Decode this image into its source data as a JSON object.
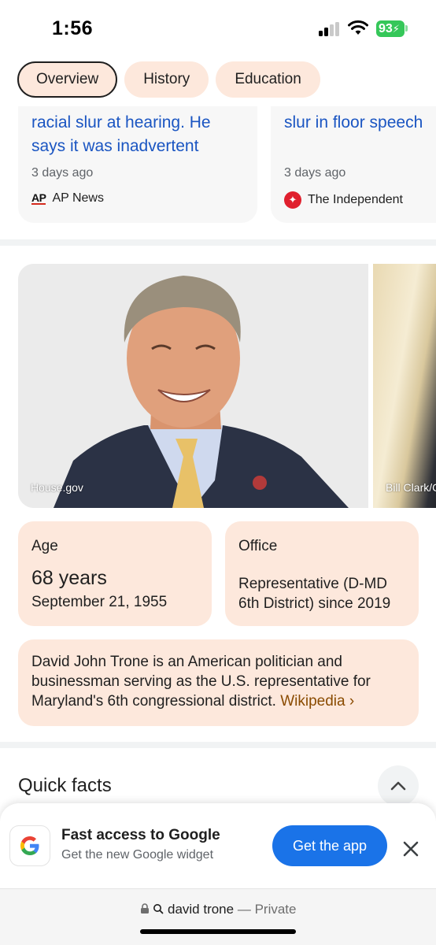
{
  "status_bar": {
    "time": "1:56",
    "battery": "93"
  },
  "tabs": [
    {
      "label": "Overview",
      "active": true
    },
    {
      "label": "History",
      "active": false
    },
    {
      "label": "Education",
      "active": false
    }
  ],
  "news": [
    {
      "headline_line1": "racial slur at hearing. He",
      "headline_line2": "says it was inadvertent",
      "time": "3 days ago",
      "source": "AP News",
      "logo": "AP"
    },
    {
      "headline_line1": "slur in floor speech",
      "time": "3 days ago",
      "source": "The Independent"
    }
  ],
  "photos": [
    {
      "credit": "House.gov"
    },
    {
      "credit": "Bill Clark/C"
    }
  ],
  "age": {
    "label": "Age",
    "value": "68 years",
    "date": "September 21, 1955"
  },
  "office": {
    "label": "Office",
    "value": "Representative (D-MD 6th District) since 2019"
  },
  "description": {
    "text": "David John Trone is an American politician and businessman serving as the U.S. representative for Maryland's 6th congressional district.",
    "link": "Wikipedia ›"
  },
  "quick_facts": {
    "title": "Quick facts"
  },
  "promo": {
    "title": "Fast access to Google",
    "subtitle": "Get the new Google widget",
    "button": "Get the app"
  },
  "address_bar": {
    "query": "david trone",
    "mode": "— Private"
  },
  "colors": {
    "accent_blue": "#1a73e8",
    "link_blue": "#1a55c2",
    "chip_bg": "#fde8dc",
    "wiki_link": "#8a4b00"
  }
}
